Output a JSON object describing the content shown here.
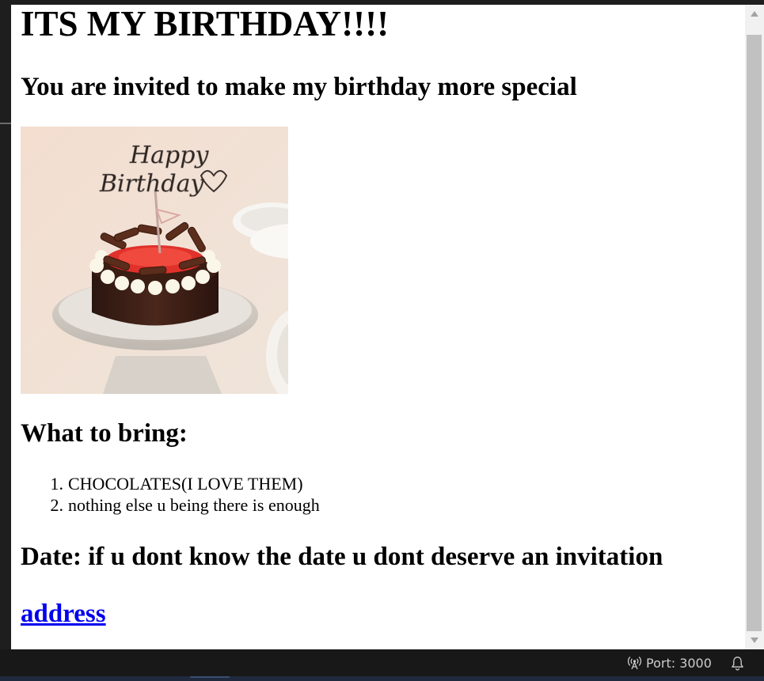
{
  "page": {
    "heading": "ITS MY BIRTHDAY!!!!",
    "subheading": "You are invited to make my birthday more special",
    "image": {
      "topper_text_line1": "Happy",
      "topper_text_line2": "Birthday"
    },
    "bring_heading": "What to bring:",
    "bring_items": [
      {
        "number": "1.",
        "text": "CHOCOLATES(I LOVE THEM)"
      },
      {
        "number": "2.",
        "text": "nothing else u being there is enough"
      }
    ],
    "date_heading": "Date: if u dont know the date u dont deserve an invitation",
    "address_link": "address"
  },
  "statusbar": {
    "port_label": "Port: 3000",
    "port_icon": "broadcast-icon",
    "bell_icon": "bell-icon"
  },
  "colors": {
    "link": "#0000ee",
    "statusbar_bg": "#181818",
    "statusbar_text": "#cccccc",
    "scroll_thumb": "#c1c1c1"
  }
}
